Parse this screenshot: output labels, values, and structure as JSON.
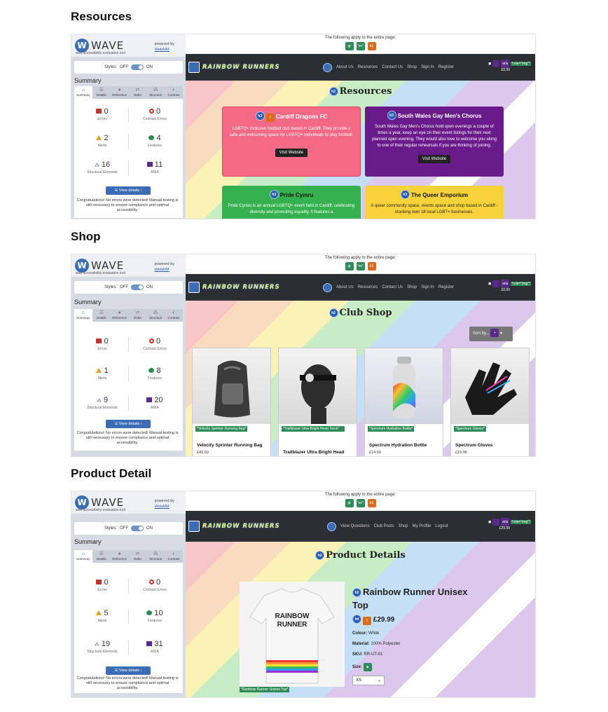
{
  "sections": [
    {
      "title": "Resources"
    },
    {
      "title": "Shop"
    },
    {
      "title": "Product Detail"
    }
  ],
  "wave": {
    "brand": "WAVE",
    "subtitle": "web accessibility evaluation tool",
    "powered_by": "powered by",
    "webaim": "WebAIM",
    "styles_label": "Styles:",
    "off": "OFF",
    "on": "ON",
    "summary": "Summary",
    "tabs": [
      "Summary",
      "Details",
      "Reference",
      "Order",
      "Structure",
      "Contrast"
    ],
    "errors_label": "Errors",
    "contrast_label": "Contrast Errors",
    "alerts_label": "Alerts",
    "features_label": "Features",
    "structural_label": "Structural Elements",
    "aria_label": "ARIA",
    "view_details": "View details",
    "congrats": "Congratulations! No errors were detected! Manual testing is still necessary to ensure compliance and optimal accessibility."
  },
  "screens": [
    {
      "errors": "0",
      "contrast": "0",
      "alerts": "2",
      "features": "4",
      "structural": "16",
      "aria": "11"
    },
    {
      "errors": "0",
      "contrast": "0",
      "alerts": "1",
      "features": "8",
      "structural": "9",
      "aria": "20"
    },
    {
      "errors": "0",
      "contrast": "0",
      "alerts": "5",
      "features": "10",
      "structural": "19",
      "aria": "31"
    }
  ],
  "site": {
    "applies_text": "The following apply to the entire page:",
    "lang_tag": "\"en\"",
    "h1_tag": "h1",
    "brand": "RAINBOW RUNNERS",
    "role_tag": "*role=\"img\"*",
    "aria_tag": "aria",
    "cart_total_1": "£0.00",
    "cart_total_3": "£29.99",
    "nav_guest": [
      "About Us",
      "Resources",
      "Contact Us",
      "Shop",
      "Sign In",
      "Register"
    ],
    "nav_user": [
      "View Questions",
      "Club Posts",
      "Shop",
      "My Profile",
      "Logout"
    ]
  },
  "resources": {
    "heading": "Resources",
    "h2": "h2",
    "h3": "h3",
    "cards": [
      {
        "title": "Cardiff Dragons FC",
        "desc": "LGBTQ+ inclusive football club based in Cardiff. They provide a safe and welcoming space for LGBTQ+ individuals to play football.",
        "button": "Visit Website",
        "color": "#f46a86"
      },
      {
        "title": "South Wales Gay Men's Chorus",
        "desc": "South Wales Gay Men's Chorus hold open evenings a couple of times a year, keep an eye on their event listings for their next planned open evening. They would also love to welcome you along to one of their regular rehearsals if you are thinking of joining.",
        "button": "Visit Website",
        "color": "#6a1b8a"
      },
      {
        "title": "Pride Cymru",
        "desc": "Pride Cymru is an annual LGBTQ+ event held in Cardiff, celebrating diversity and promoting equality. It features a",
        "button": "",
        "color": "#35b24f"
      },
      {
        "title": "The Queer Emporium",
        "desc": "A queer community space, events space and shop based in Cardiff - stocking over 18 local LGBT+ businesses.",
        "button": "",
        "color": "#f7d238"
      }
    ]
  },
  "shop": {
    "heading": "Club Shop",
    "sort_label": "Sort by...",
    "products": [
      {
        "alt": "*Velocity Sprinter Running Bag*",
        "name": "Velocity Sprinter Running Bag",
        "price": "£43.50"
      },
      {
        "alt": "*Trailblazer Ultra Bright Head Torch*",
        "name": "Trailblazer Ultra Bright Head",
        "price": ""
      },
      {
        "alt": "*Spectrum Hydration Bottle*",
        "name": "Spectrum Hydration Bottle",
        "price": "£14.50"
      },
      {
        "alt": "*Spectrum Gloves*",
        "name": "Spectrum Gloves",
        "price": "£19.95"
      }
    ]
  },
  "detail": {
    "heading": "Product Details",
    "title": "Rainbow Runner Unisex Top",
    "h4": "h4",
    "price": "£29.99",
    "colour_label": "Colour:",
    "colour": "White",
    "material_label": "Material:",
    "material": "100% Polyester",
    "sku_label": "SKU:",
    "sku": "RR-UT-01",
    "size_label": "Size:",
    "size_value": "XS",
    "img_alt": "*Rainbow Runner Unisex Top*",
    "shirt_text_1": "RAINBOW",
    "shirt_text_2": "RUNNER"
  },
  "colors": {
    "wave_blue": "#3a6db5",
    "error_red": "#c9302c",
    "alert_orange": "#e4a11b",
    "feature_green": "#2e8b57",
    "aria_purple": "#5a2a8a",
    "navbar": "#2b2f33"
  }
}
